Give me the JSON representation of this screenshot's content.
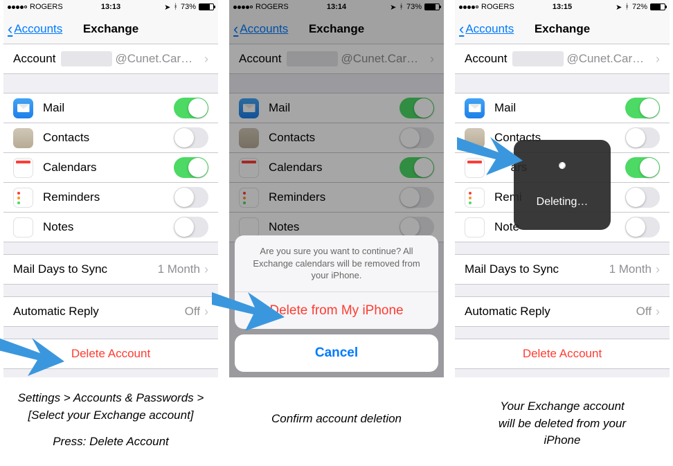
{
  "statusbar": {
    "carrier": "ROGERS",
    "bluetooth_icon": "bluetooth",
    "location_icon": "location-arrow",
    "times": [
      "13:13",
      "13:14",
      "13:15"
    ],
    "battery": [
      "73%",
      "73%",
      "72%"
    ]
  },
  "nav": {
    "back_label": "Accounts",
    "title": "Exchange"
  },
  "account_row": {
    "label": "Account",
    "value_suffix": "@Cunet.Car…"
  },
  "toggles": [
    {
      "name": "Mail",
      "icon": "mail",
      "on": true
    },
    {
      "name": "Contacts",
      "icon": "contacts",
      "on": false
    },
    {
      "name": "Calendars",
      "icon": "calendars",
      "on": true
    },
    {
      "name": "Reminders",
      "icon": "reminders",
      "on": false
    },
    {
      "name": "Notes",
      "icon": "notes",
      "on": false
    }
  ],
  "sync_row": {
    "label": "Mail Days to Sync",
    "value": "1 Month"
  },
  "auto_reply_row": {
    "label": "Automatic Reply",
    "value": "Off"
  },
  "delete_label": "Delete Account",
  "sheet": {
    "message": "Are you sure you want to continue? All Exchange calendars will be removed from your iPhone.",
    "destructive": "Delete from My iPhone",
    "cancel": "Cancel"
  },
  "hud": {
    "label": "Deleting…"
  },
  "captions": {
    "c1_line1": "Settings > Accounts & Passwords >",
    "c1_line2": "[Select your Exchange account]",
    "c1_line3": "Press: Delete Account",
    "c2": "Confirm account deletion",
    "c3_line1": "Your Exchange account",
    "c3_line2": "will be deleted from your",
    "c3_line3": "iPhone"
  }
}
